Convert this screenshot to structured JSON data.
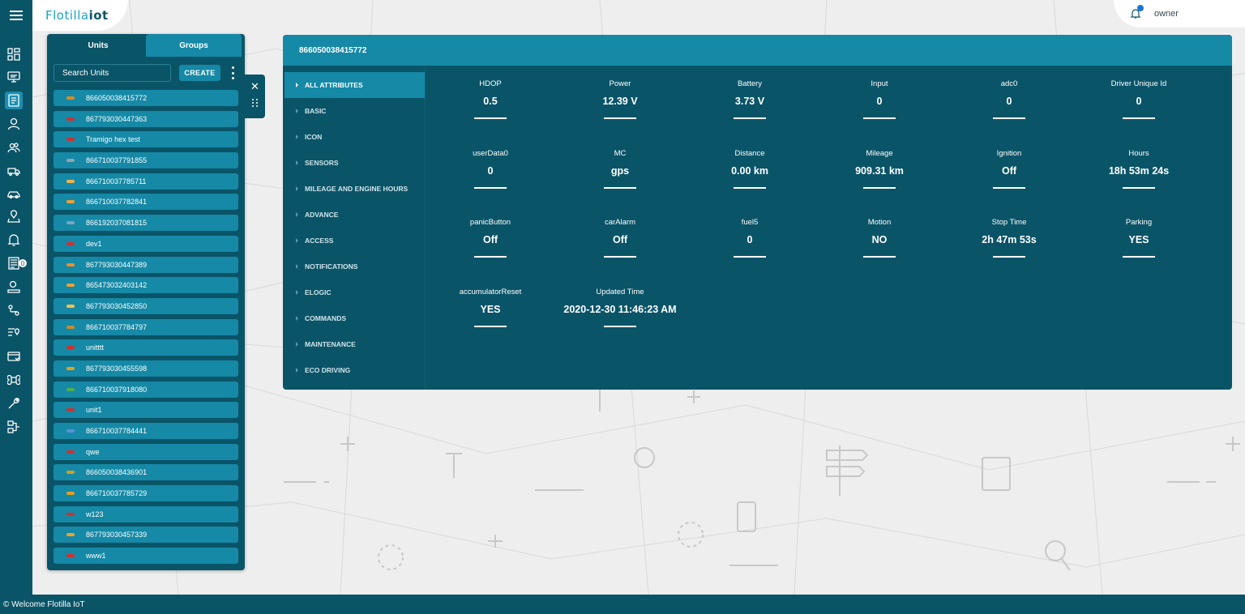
{
  "app": {
    "logo_text": "Flotilla",
    "logo_suffix": "iot",
    "user_name": "owner",
    "footer_text": "© Welcome Flotilla IoT"
  },
  "rail": {
    "icons": [
      "dashboard-icon",
      "monitor-icon",
      "units-list-icon",
      "user-icon",
      "users-group-icon",
      "truck-icon",
      "car-icon",
      "geofence-icon",
      "alarm-icon",
      "report-icon",
      "driver-icon",
      "route-icon",
      "poi-icon",
      "billing-icon",
      "command-icon",
      "wrench-icon",
      "workflow-icon"
    ],
    "alarm_count": "0"
  },
  "units_panel": {
    "tabs": [
      "Units",
      "Groups"
    ],
    "search_placeholder": "Search Units",
    "create_label": "CREATE",
    "units": [
      {
        "name": "866050038415772",
        "color": "#e08a1e"
      },
      {
        "name": "867793030447363",
        "color": "#d32f2f"
      },
      {
        "name": "Tramigo hex test",
        "color": "#d32f2f"
      },
      {
        "name": "866710037791855",
        "color": "#90a4ae"
      },
      {
        "name": "866710037785711",
        "color": "#f0b14a"
      },
      {
        "name": "866710037782841",
        "color": "#f0a030"
      },
      {
        "name": "866192037081815",
        "color": "#7aa6c2"
      },
      {
        "name": "dev1",
        "color": "#d32f2f"
      },
      {
        "name": "867793030447389",
        "color": "#f28c28"
      },
      {
        "name": "865473032403142",
        "color": "#f0a030"
      },
      {
        "name": "867793030452850",
        "color": "#f2c14a"
      },
      {
        "name": "866710037784797",
        "color": "#c98a2e"
      },
      {
        "name": "unitttt",
        "color": "#d32f2f"
      },
      {
        "name": "867793030455598",
        "color": "#e0a020"
      },
      {
        "name": "866710037918080",
        "color": "#4caf50"
      },
      {
        "name": "unit1",
        "color": "#d32f2f"
      },
      {
        "name": "866710037784441",
        "color": "#5b8fd6"
      },
      {
        "name": "qwe",
        "color": "#d32f2f"
      },
      {
        "name": "866050038436901",
        "color": "#c9a227"
      },
      {
        "name": "866710037785729",
        "color": "#e0a020"
      },
      {
        "name": "w123",
        "color": "#d32f2f"
      },
      {
        "name": "867793030457339",
        "color": "#f0a030"
      },
      {
        "name": "www1",
        "color": "#d32f2f"
      }
    ]
  },
  "detail": {
    "title": "866050038415772",
    "menu": [
      "ALL ATTRIBUTES",
      "BASIC",
      "ICON",
      "SENSORS",
      "MILEAGE AND ENGINE HOURS",
      "ADVANCE",
      "ACCESS",
      "NOTIFICATIONS",
      "ELOGIC",
      "COMMANDS",
      "MAINTENANCE",
      "ECO DRIVING"
    ],
    "active_menu": 0,
    "attributes": [
      {
        "label": "HDOP",
        "value": "0.5"
      },
      {
        "label": "Power",
        "value": "12.39 V"
      },
      {
        "label": "Battery",
        "value": "3.73 V"
      },
      {
        "label": "Input",
        "value": "0"
      },
      {
        "label": "adc0",
        "value": "0"
      },
      {
        "label": "Driver Unique Id",
        "value": "0"
      },
      {
        "label": "userData0",
        "value": "0"
      },
      {
        "label": "MC",
        "value": "gps"
      },
      {
        "label": "Distance",
        "value": "0.00 km"
      },
      {
        "label": "Mileage",
        "value": "909.31 km"
      },
      {
        "label": "Ignition",
        "value": "Off"
      },
      {
        "label": "Hours",
        "value": "18h 53m 24s"
      },
      {
        "label": "panicButton",
        "value": "Off"
      },
      {
        "label": "carAlarm",
        "value": "Off"
      },
      {
        "label": "fuel5",
        "value": "0"
      },
      {
        "label": "Motion",
        "value": "NO"
      },
      {
        "label": "Stop Time",
        "value": "2h 47m 53s"
      },
      {
        "label": "Parking",
        "value": "YES"
      },
      {
        "label": "accumulatorReset",
        "value": "YES"
      },
      {
        "label": "Updated Time",
        "value": "2020-12-30 11:46:23 AM"
      }
    ]
  },
  "colors": {
    "primary": "#0a5468",
    "accent": "#1589a6",
    "background": "#eeeeef"
  }
}
